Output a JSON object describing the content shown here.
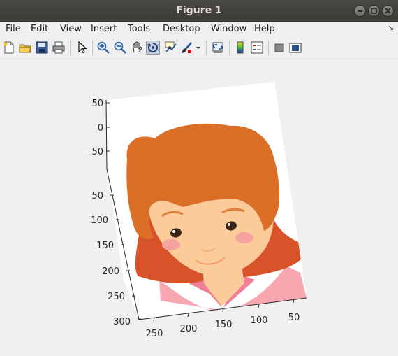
{
  "window": {
    "title": "Figure 1"
  },
  "menu": {
    "items": [
      "File",
      "Edit",
      "View",
      "Insert",
      "Tools",
      "Desktop",
      "Window",
      "Help"
    ],
    "dock_glyph": "↘"
  },
  "toolbar": {
    "buttons": [
      "new-figure-icon",
      "open-file-icon",
      "save-icon",
      "print-icon",
      "edit-plot-pointer-icon",
      "zoom-in-icon",
      "zoom-out-icon",
      "pan-hand-icon",
      "rotate-3d-icon",
      "data-cursor-icon",
      "brush-icon",
      "link-plot-icon",
      "colorbar-icon",
      "legend-icon",
      "hide-plot-tools-icon",
      "show-plot-tools-icon"
    ],
    "active": "rotate-3d-icon"
  },
  "axes": {
    "z_ticks": [
      "50",
      "0",
      "-50"
    ],
    "y_ticks": [
      "50",
      "100",
      "150",
      "200",
      "250",
      "300"
    ],
    "x_ticks": [
      "250",
      "200",
      "150",
      "100",
      "50"
    ]
  },
  "colors": {
    "hair": "#dc6f28",
    "hair_back": "#d9532a",
    "skin": "#fbcb99",
    "collar": "#f6a3ac",
    "shirt": "#f8a6b0",
    "cheek": "#f4a3a0",
    "eye": "#3b2416"
  }
}
